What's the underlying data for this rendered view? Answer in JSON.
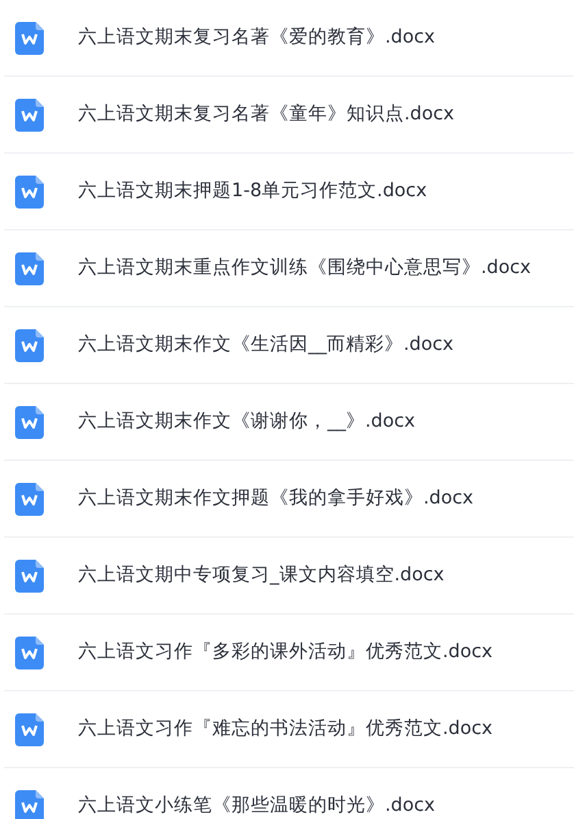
{
  "files": [
    {
      "name": "六上语文期末复习名著《爱的教育》.docx"
    },
    {
      "name": "六上语文期末复习名著《童年》知识点.docx"
    },
    {
      "name": "六上语文期末押题1-8单元习作范文.docx"
    },
    {
      "name": "六上语文期末重点作文训练《围绕中心意思写》.docx"
    },
    {
      "name": "六上语文期末作文《生活因__而精彩》.docx"
    },
    {
      "name": "六上语文期末作文《谢谢你，__》.docx"
    },
    {
      "name": "六上语文期末作文押题《我的拿手好戏》.docx"
    },
    {
      "name": "六上语文期中专项复习_课文内容填空.docx"
    },
    {
      "name": "六上语文习作『多彩的课外活动』优秀范文.docx"
    },
    {
      "name": "六上语文习作『难忘的书法活动』优秀范文.docx"
    },
    {
      "name": "六上语文小练笔《那些温暖的时光》.docx"
    }
  ]
}
